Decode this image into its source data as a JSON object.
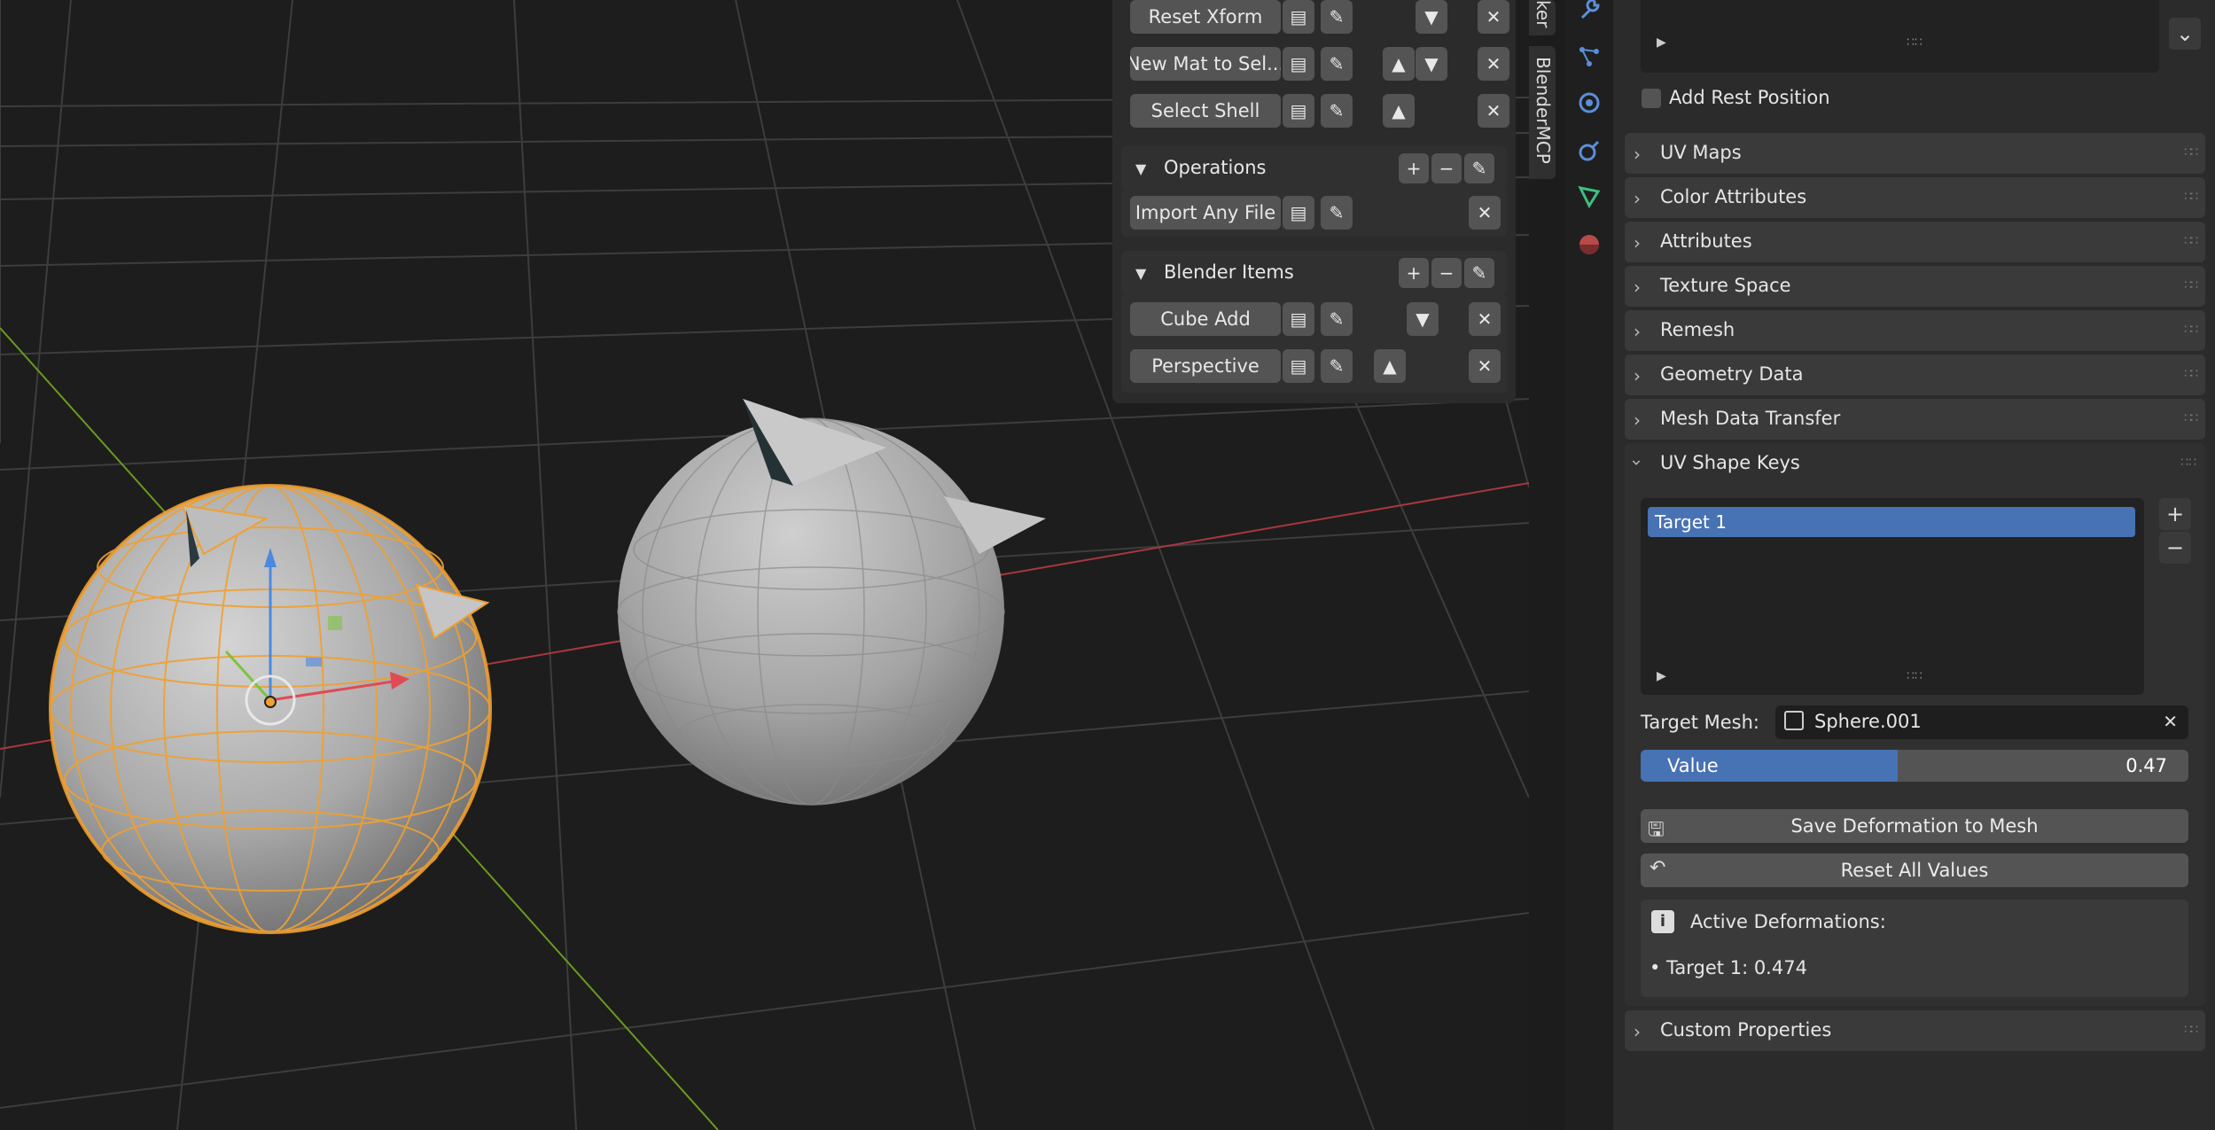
{
  "floating_panel": {
    "rows_top": [
      {
        "label": "Reset Xform"
      },
      {
        "label": "New Mat to Sel..."
      },
      {
        "label": "Select Shell"
      }
    ],
    "operations": {
      "title": "Operations",
      "items": [
        {
          "label": "Import Any File"
        }
      ]
    },
    "blender_items": {
      "title": "Blender Items",
      "items": [
        {
          "label": "Cube Add"
        },
        {
          "label": "Perspective"
        }
      ]
    }
  },
  "side_tabs": {
    "top_partial": "ker",
    "blendermcp": "BlenderMCP"
  },
  "properties": {
    "add_rest_position": {
      "label": "Add Rest Position",
      "checked": false
    },
    "panels": [
      {
        "label": "UV Maps",
        "expanded": false
      },
      {
        "label": "Color Attributes",
        "expanded": false
      },
      {
        "label": "Attributes",
        "expanded": false
      },
      {
        "label": "Texture Space",
        "expanded": false
      },
      {
        "label": "Remesh",
        "expanded": false
      },
      {
        "label": "Geometry Data",
        "expanded": false
      },
      {
        "label": "Mesh Data Transfer",
        "expanded": false
      },
      {
        "label": "UV Shape Keys",
        "expanded": true
      }
    ],
    "uv_shape_keys": {
      "list": [
        "Target 1"
      ],
      "selected": 0,
      "target_mesh_label": "Target Mesh:",
      "target_mesh_value": "Sphere.001",
      "value_label": "Value",
      "value": "0.47",
      "value_fraction": 0.47,
      "save_button": "Save Deformation to Mesh",
      "reset_button": "Reset All Values",
      "info_title": "Active Deformations:",
      "info_item": "• Target 1: 0.474"
    },
    "custom_properties": "Custom Properties"
  },
  "colors": {
    "accent_blue": "#4772b3",
    "selection_orange": "#f0a030",
    "x_axis": "#a8373f",
    "y_axis": "#6a9a1f"
  }
}
